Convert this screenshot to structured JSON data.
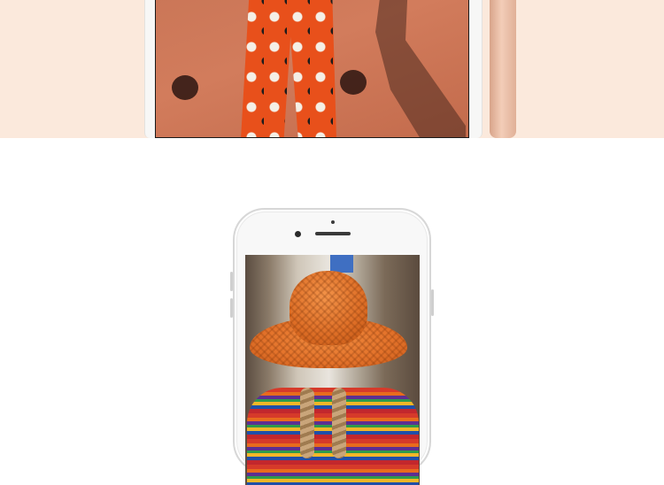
{
  "top_photo": {
    "caption": "",
    "colors": {
      "band": "#fbe9dc",
      "wall": "#d27c5c",
      "pants": "#e8501b",
      "phone_gold": "#f3cdb8"
    }
  },
  "feature_phone": {
    "caption": "",
    "colors": {
      "body": "#f8f8f8",
      "hat": "#e4732b",
      "screen_bg": "#151515"
    }
  }
}
